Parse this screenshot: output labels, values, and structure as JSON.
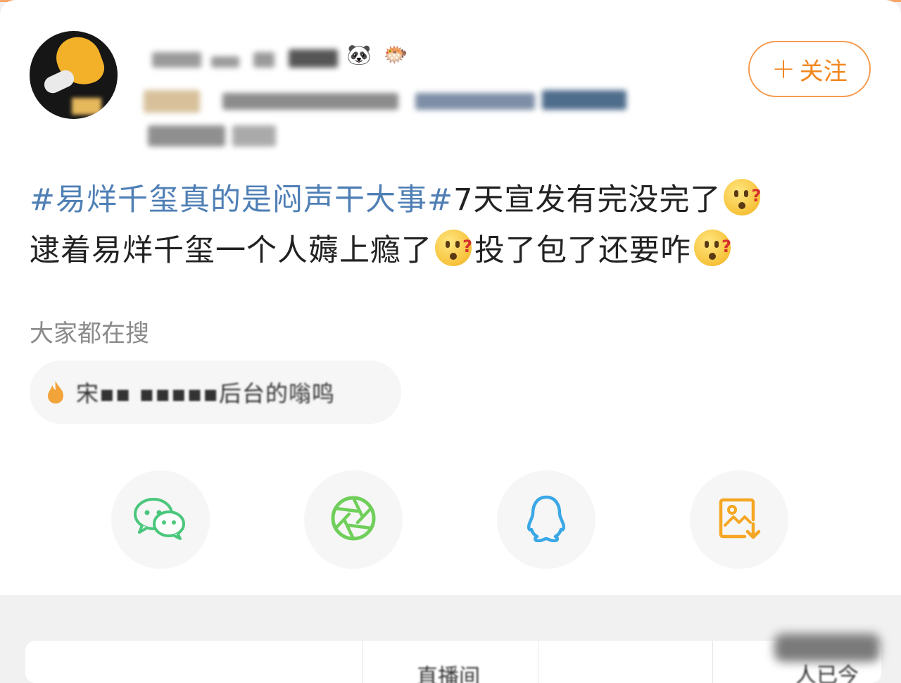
{
  "profile": {
    "follow_label": "关注",
    "follow_plus": "+",
    "badge_panda": "🐼",
    "badge_fish": "🐡"
  },
  "post": {
    "hashtag": "#易烊千玺真的是闷声干大事#",
    "line1_rest": "7天宣发有完没完了",
    "line2_a": "逮着易烊千玺一个人薅上瘾了",
    "line2_b": "投了包了还要咋"
  },
  "search": {
    "title": "大家都在搜",
    "chip_text": "宋▪▪ ▪▪▪▪▪后台的嗡鸣"
  },
  "share": {
    "icons": [
      "wechat-icon",
      "moments-icon",
      "qq-icon",
      "save-image-icon"
    ],
    "colors": {
      "wechat": "#4bc77c",
      "moments": "#6fcf5a",
      "qq": "#3aa7e6",
      "save": "#f5a623"
    }
  },
  "tabs": {
    "middle_label": "直播间",
    "right_label": "人已今"
  }
}
